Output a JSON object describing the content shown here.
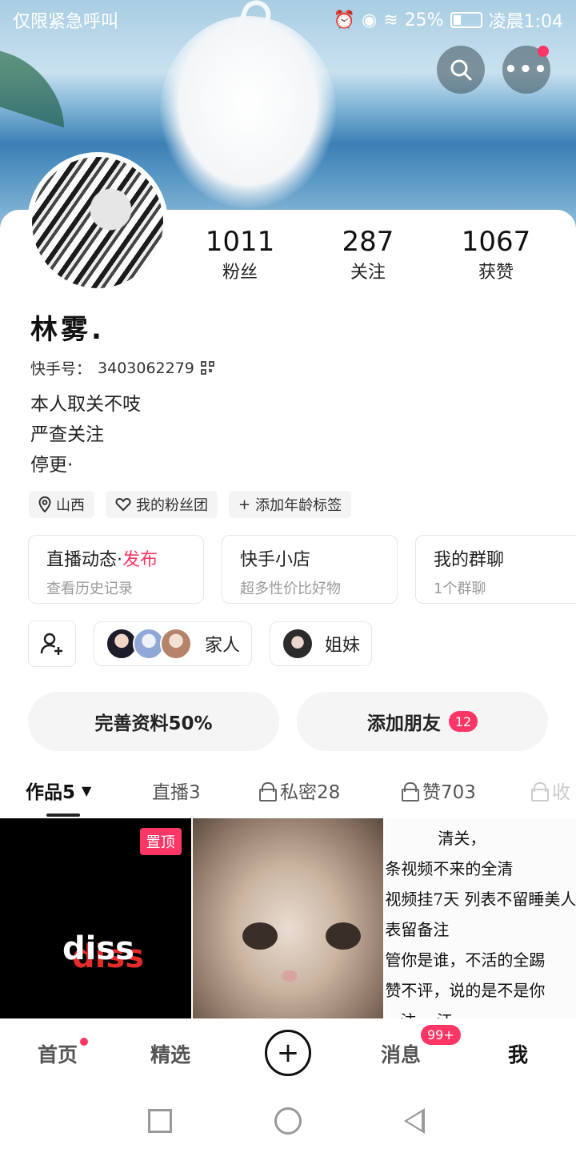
{
  "status_bar": {
    "carrier": "仅限紧急呼叫",
    "battery": "25%",
    "time": "凌晨1:04"
  },
  "profile": {
    "name": "林雾.",
    "kuaishou_id_label": "快手号：",
    "kuaishou_id": "3403062279",
    "bio": [
      "本人取关不吱",
      "严查关注",
      "停更·"
    ],
    "stats": [
      {
        "value": "1011",
        "label": "粉丝"
      },
      {
        "value": "287",
        "label": "关注"
      },
      {
        "value": "1067",
        "label": "获赞"
      }
    ]
  },
  "tags": [
    {
      "icon": "location-icon",
      "label": "山西"
    },
    {
      "icon": "heart-icon",
      "label": "我的粉丝团"
    },
    {
      "icon": "plus-icon",
      "label": "添加年龄标签"
    }
  ],
  "features": [
    {
      "title": "直播动态",
      "accent": "发布",
      "sub": "查看历史记录"
    },
    {
      "title": "快手小店",
      "accent": "",
      "sub": "超多性价比好物"
    },
    {
      "title": "我的群聊",
      "accent": "",
      "sub": "1个群聊"
    }
  ],
  "groups": [
    {
      "label": "家人"
    },
    {
      "label": "姐妹"
    }
  ],
  "actions": {
    "complete_profile": "完善资料50%",
    "add_friends": "添加朋友",
    "add_friends_badge": "12"
  },
  "tabs": [
    {
      "label": "作品5",
      "active": true
    },
    {
      "label": "直播3"
    },
    {
      "label": "私密28",
      "icon": "lock-icon"
    },
    {
      "label": "赞703",
      "icon": "lock-icon"
    },
    {
      "label": "收",
      "icon": "lock-icon"
    }
  ],
  "posts": {
    "pinned_label": "置顶",
    "post1_text_white": "diss",
    "post1_text_red": "diss",
    "post3_lines": [
      "清关，",
      "条视频不来的全清",
      "视频挂7天 列表不留睡美人",
      "表留备注",
      "管你是谁，不活的全踢",
      "赞不评，说的是不是你",
      "...注 ...江"
    ]
  },
  "bottom_nav": {
    "home": "首页",
    "featured": "精选",
    "messages": "消息",
    "messages_badge": "99+",
    "me": "我"
  },
  "colors": {
    "accent": "#fe3666",
    "text": "#222222"
  }
}
